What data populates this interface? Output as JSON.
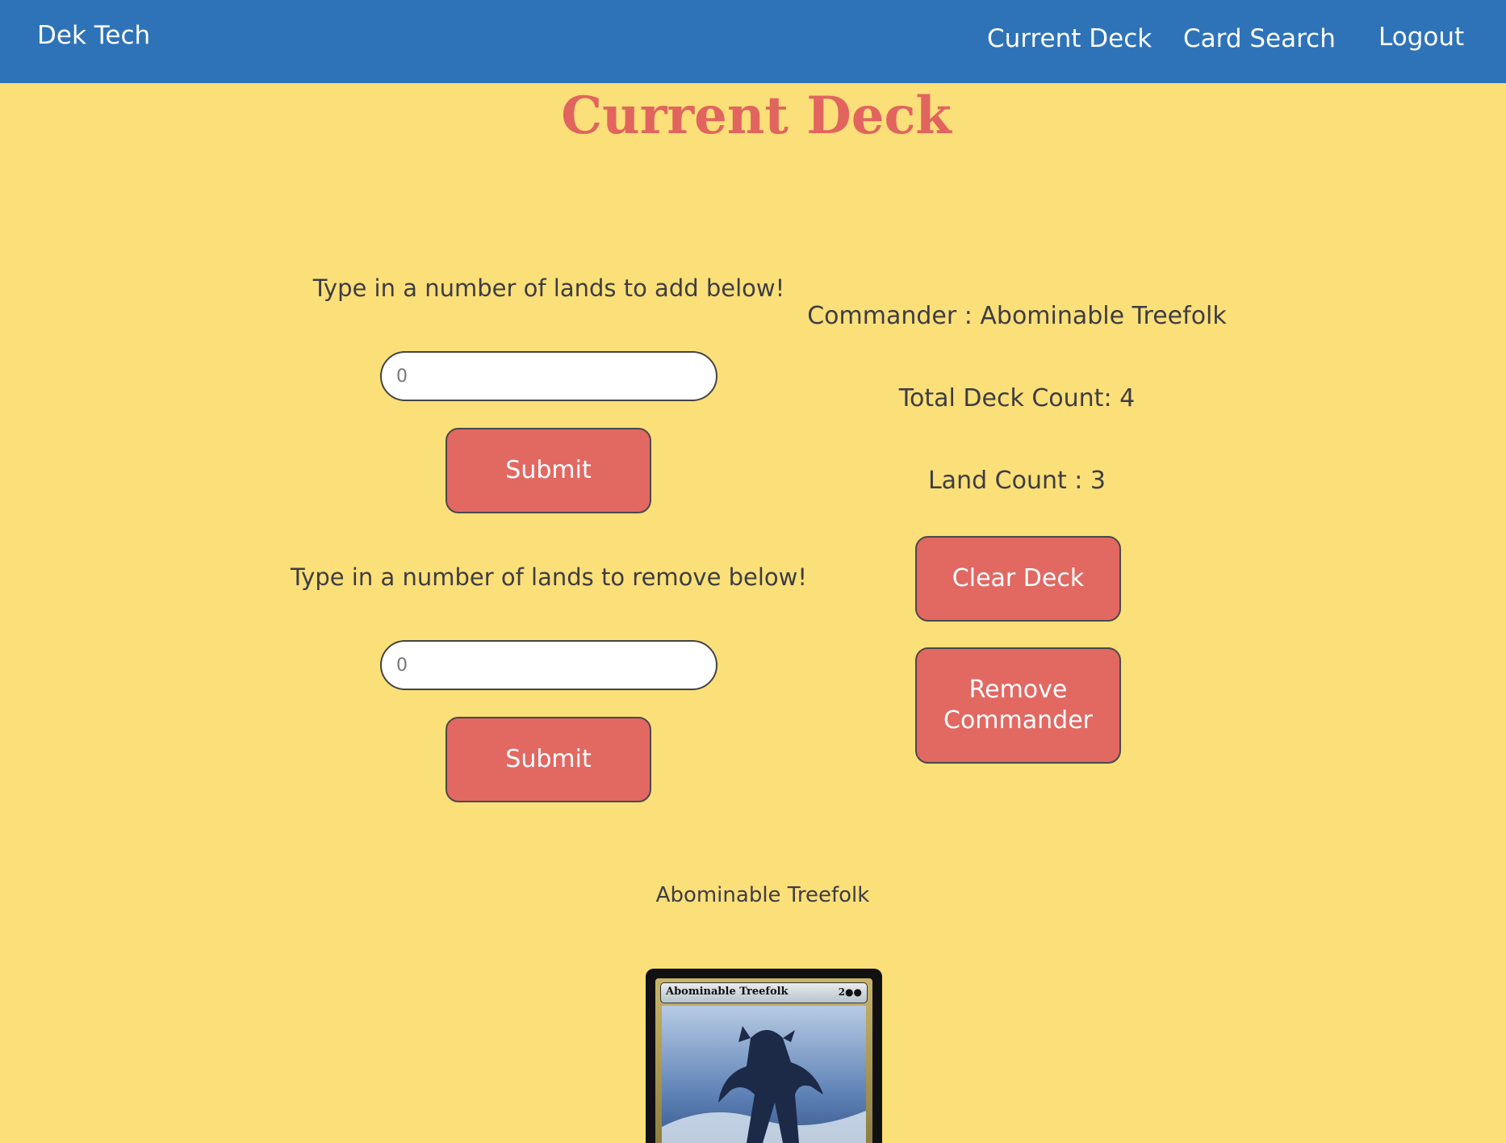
{
  "nav": {
    "brand": "Dek Tech",
    "links": [
      "Current Deck",
      "Card Search",
      "Logout"
    ]
  },
  "page": {
    "title": "Current Deck"
  },
  "add_lands": {
    "prompt": "Type in a number of lands to add below!",
    "placeholder": "0",
    "submit_label": "Submit"
  },
  "remove_lands": {
    "prompt": "Type in a number of lands to remove below!",
    "placeholder": "0",
    "submit_label": "Submit"
  },
  "deck_info": {
    "commander": "Commander : Abominable Treefolk",
    "total_count": "Total Deck Count: 4",
    "land_count": "Land Count : 3",
    "clear_label": "Clear Deck",
    "remove_commander_label": "Remove Commander"
  },
  "card": {
    "name": "Abominable Treefolk",
    "image_title": "Abominable Treefolk",
    "image_mana": "2●●"
  },
  "colors": {
    "background": "#fbdf78",
    "navbar": "#2e73b8",
    "accent": "#e1645f",
    "button": "#e26862"
  }
}
